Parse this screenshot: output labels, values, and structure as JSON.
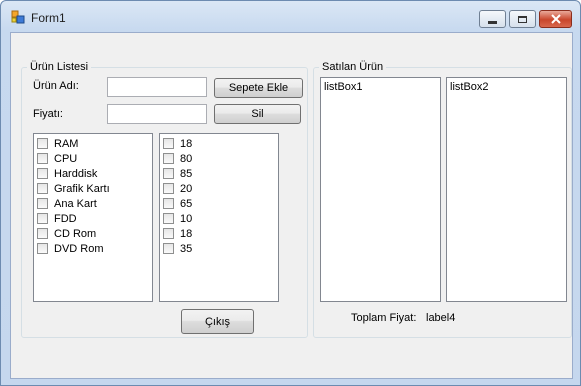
{
  "window": {
    "title": "Form1",
    "icon": "winforms-app-icon",
    "controls": [
      "minimize-icon",
      "maximize-icon",
      "close-icon"
    ]
  },
  "product_group": {
    "label": "Ürün Listesi",
    "name_label": "Ürün Adı:",
    "name_value": "",
    "price_label": "Fiyatı:",
    "price_value": "",
    "add_button": "Sepete Ekle",
    "delete_button": "Sil",
    "products": [
      "RAM",
      "CPU",
      "Harddisk",
      "Grafik Kartı",
      "Ana Kart",
      "FDD",
      "CD Rom",
      "DVD Rom"
    ],
    "prices": [
      "18",
      "80",
      "85",
      "20",
      "65",
      "10",
      "18",
      "35"
    ],
    "exit_button": "Çıkış"
  },
  "sold_group": {
    "label": "Satılan Ürün",
    "listbox1": "listBox1",
    "listbox2": "listBox2",
    "total_label": "Toplam Fiyat:",
    "total_value": "label4"
  }
}
